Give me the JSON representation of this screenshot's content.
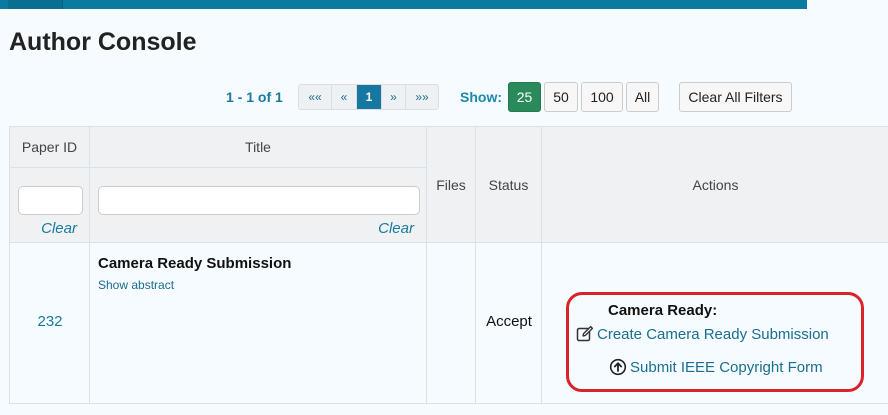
{
  "page": {
    "title": "Author Console"
  },
  "pager": {
    "info": "1 - 1 of 1",
    "first": "««",
    "prev": "«",
    "current": "1",
    "next": "»",
    "last": "»»"
  },
  "show": {
    "label": "Show:",
    "options": [
      "25",
      "50",
      "100",
      "All"
    ],
    "selected": "25",
    "clear_all": "Clear All Filters"
  },
  "table": {
    "headers": {
      "paper_id": "Paper ID",
      "title": "Title",
      "files": "Files",
      "status": "Status",
      "actions": "Actions"
    },
    "filters": {
      "paper_id_value": "",
      "title_value": "",
      "clear": "Clear"
    },
    "rows": [
      {
        "paper_id": "232",
        "title": "Camera Ready Submission",
        "show_abstract": "Show abstract",
        "files": "",
        "status": "Accept",
        "actions": {
          "section_label": "Camera Ready:",
          "create": "Create Camera Ready Submission",
          "copyright": "Submit IEEE Copyright Form"
        }
      }
    ]
  },
  "colors": {
    "accent": "#1a7a9c",
    "highlight": "#d9222a",
    "active_page": "#1677a0",
    "active_show": "#2a8a5a"
  }
}
